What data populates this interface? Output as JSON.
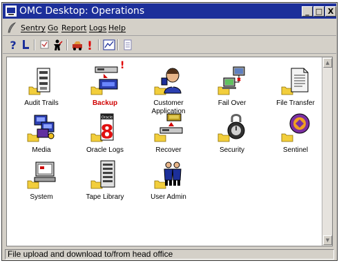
{
  "window": {
    "title": "OMC Desktop: Operations",
    "minimize_glyph": "_",
    "maximize_glyph": "□",
    "close_glyph": "X"
  },
  "menu": [
    "Sentry",
    "Go",
    "Report",
    "Logs",
    "Help"
  ],
  "toolbar_icons": [
    "help-icon",
    "pointer-icon",
    "checkbox-icon",
    "user-icon",
    "car-icon",
    "alert-icon",
    "chart-icon",
    "document-icon"
  ],
  "items": [
    {
      "label": "Audit Trails",
      "icon": "audit-trails-icon"
    },
    {
      "label": "Backup",
      "icon": "backup-icon",
      "color": "#d00000"
    },
    {
      "label": "Customer Application",
      "icon": "customer-application-icon"
    },
    {
      "label": "Fail Over",
      "icon": "fail-over-icon"
    },
    {
      "label": "File Transfer",
      "icon": "file-transfer-icon"
    },
    {
      "label": "Media",
      "icon": "media-icon"
    },
    {
      "label": "Oracle Logs",
      "icon": "oracle-logs-icon",
      "badge": "Oracle",
      "digit": "8"
    },
    {
      "label": "Recover",
      "icon": "recover-icon"
    },
    {
      "label": "Security",
      "icon": "security-icon"
    },
    {
      "label": "Sentinel",
      "icon": "sentinel-icon"
    },
    {
      "label": "System",
      "icon": "system-icon"
    },
    {
      "label": "Tape Library",
      "icon": "tape-library-icon"
    },
    {
      "label": "User Admin",
      "icon": "user-admin-icon"
    }
  ],
  "status": "File upload and download to/from head office"
}
